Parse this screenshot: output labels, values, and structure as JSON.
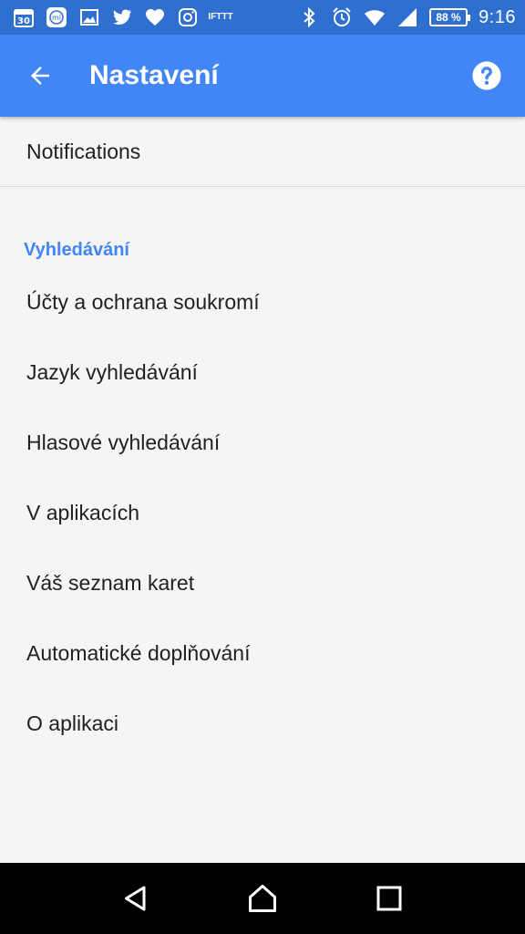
{
  "status_bar": {
    "calendar_day": "30",
    "mi_label": "mi",
    "ifttt_label": "IFTTT",
    "battery": "88 %",
    "time": "9:16",
    "icons": [
      "calendar-icon",
      "mi-fit-icon",
      "image-icon",
      "twitter-icon",
      "heart-icon",
      "instagram-icon",
      "ifttt-icon",
      "bluetooth-icon",
      "alarm-icon",
      "wifi-icon",
      "signal-icon",
      "battery-icon"
    ]
  },
  "app_bar": {
    "title": "Nastavení",
    "back_icon": "arrow-back-icon",
    "help_icon": "help-icon"
  },
  "notifications": {
    "label": "Notifications"
  },
  "search_section": {
    "header": "Vyhledávání",
    "items": [
      {
        "label": "Účty a ochrana soukromí"
      },
      {
        "label": "Jazyk vyhledávání"
      },
      {
        "label": "Hlasové vyhledávání"
      },
      {
        "label": "V aplikacích"
      },
      {
        "label": "Váš seznam karet"
      },
      {
        "label": "Automatické doplňování"
      },
      {
        "label": "O aplikaci"
      }
    ]
  },
  "nav_bar": {
    "icons": [
      "back-triangle-icon",
      "home-icon",
      "recents-icon"
    ]
  },
  "colors": {
    "status_bar": "#2f6fd0",
    "app_bar": "#4285f4",
    "accent": "#4285f4",
    "background": "#f5f5f5"
  }
}
